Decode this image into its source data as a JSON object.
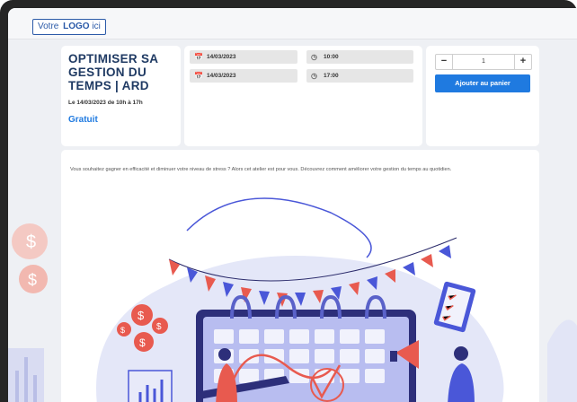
{
  "header": {
    "logo_prefix": "Votre",
    "logo_bold": "LOGO",
    "logo_suffix": "ici"
  },
  "event": {
    "title": "OPTIMISER SA GESTION DU TEMPS | ARD",
    "date_line": "Le 14/03/2023 de 10h à 17h",
    "price": "Gratuit"
  },
  "schedule": {
    "start_date": "14/03/2023",
    "start_time": "10:00",
    "end_date": "14/03/2023",
    "end_time": "17:00"
  },
  "cart": {
    "minus": "−",
    "quantity": "1",
    "plus": "+",
    "add_label": "Ajouter au panier"
  },
  "description": "Vous souhaitez gagner en efficacité et diminuer votre niveau de stress ? Alors cet atelier est pour vous. Découvrez comment améliorer votre gestion du temps au quotidien.",
  "colors": {
    "accent": "#1f7ae0",
    "title": "#1f3a63",
    "illustration_blue": "#4a57d8",
    "illustration_red": "#e85a4f"
  },
  "icons": {
    "date": "calendar-icon",
    "time": "clock-icon"
  }
}
